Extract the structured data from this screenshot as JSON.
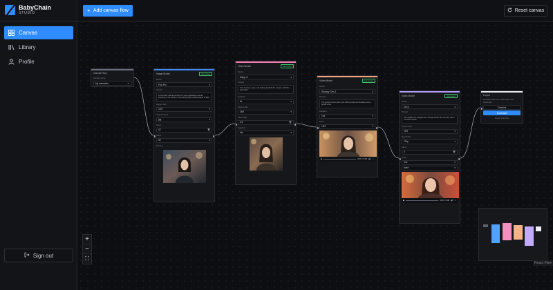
{
  "brand": {
    "name": "BabyChain",
    "sub": "STUDIO"
  },
  "nav": [
    {
      "label": "Canvas",
      "icon": "canvas-icon",
      "active": true
    },
    {
      "label": "Library",
      "icon": "library-icon",
      "active": false
    },
    {
      "label": "Profile",
      "icon": "profile-icon",
      "active": false
    }
  ],
  "sidebar": {
    "signout_label": "Sign out"
  },
  "topbar": {
    "add_label": "Add canvas flow",
    "reset_label": "Reset canvas"
  },
  "zoom": {
    "in": "+",
    "out": "−",
    "fit": "⛶"
  },
  "attribution": "React Flow",
  "colors": {
    "accent": "#2f8cff",
    "edge": "#9aa0aa",
    "node_image": "#3d8bfd",
    "node_video": "#f47fb0",
    "node_video2": "#f0a27a",
    "node_video3": "#b59cff",
    "node_export": "#e9ecf1"
  },
  "nodes": {
    "input": {
      "title": "Canvas Flow",
      "lbl": "Canvas name",
      "value": "My animation"
    },
    "image": {
      "title": "Image Model",
      "badge": "Generated",
      "lbl_model": "Model",
      "model": "Flux Pro",
      "lbl_prompt": "Prompt",
      "prompt": "A cinematic natural portrait of a young Japanese woman standing on the street in soft evening light, shallow depth of field.",
      "lbl_ar": "Aspect ratio",
      "ar": "16:9",
      "lbl_fmt": "Output format",
      "fmt": "jpg",
      "lbl_seed": "Seed",
      "seed": "42",
      "lbl_steps": "Steps",
      "steps": "30",
      "lbl_preview": "Preview"
    },
    "video1": {
      "title": "Video Model",
      "badge": "Generated",
      "lbl_model": "Model",
      "model": "Kling v2",
      "lbl_prompt": "Prompt",
      "prompt": "Turn her face, gaze, and looking towards the camera. Soft film grain light.",
      "lbl_dur": "Duration",
      "dur": "5s",
      "lbl_ar": "Aspect ratio",
      "ar": "16:9",
      "lbl_cfg": "CFG scale",
      "cfg": "0.5",
      "lbl_neg": "Negative",
      "neg": "blur"
    },
    "video2": {
      "title": "Video Model",
      "badge": "Generated",
      "lbl_model": "Model",
      "model": "Runway Gen-3",
      "lbl_prompt": "Prompt",
      "prompt": "The portrait comes alive, she blinks slowly and breathes with a gentle smile.",
      "lbl_dur": "Duration",
      "dur": "10s",
      "lbl_ratio": "Ratio",
      "ratio": "16:9",
      "time": "0:00 / 0:05"
    },
    "video3": {
      "title": "Video Model",
      "badge": "Generated",
      "lbl_model": "Model",
      "model": "Veo 3",
      "lbl_prompt": "Prompt",
      "prompt": "She speaks her thoughts as a foreign breeze lifts her hair, warm cinematic bokeh.",
      "lbl_ar": "Aspect ratio",
      "ar": "16:9",
      "lbl_res": "Resolution",
      "res": "720p",
      "lbl_seed": "Seed",
      "seed": "0",
      "lbl_audio": "Audio",
      "audio": "true",
      "lbl_neg": "Negative",
      "neg": "none",
      "time": "0:00 / 0:08"
    },
    "export": {
      "title": "Export",
      "desc": "Combine clips into a final video and download.",
      "btn1": "Combine",
      "btn2": "Download",
      "lbl": "Export video file"
    }
  }
}
